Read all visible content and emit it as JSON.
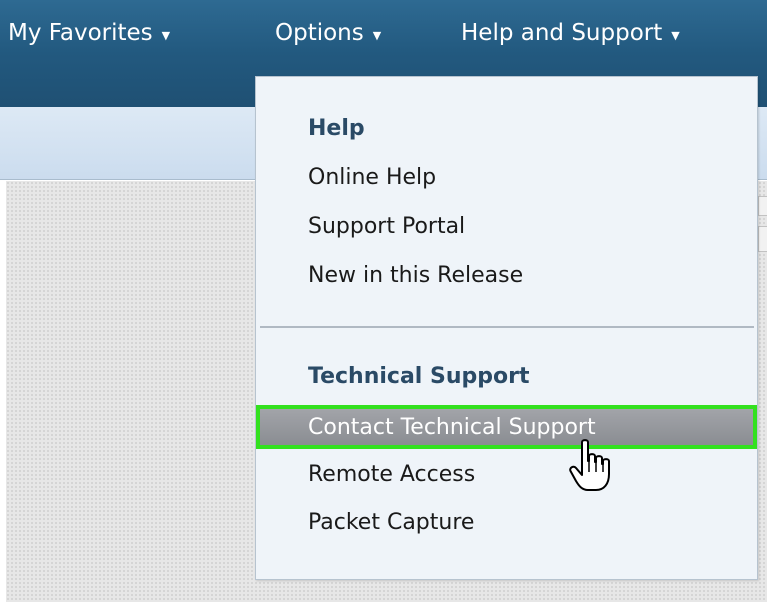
{
  "nav": {
    "favorites": "My Favorites",
    "options": "Options",
    "help_support": "Help and Support"
  },
  "dropdown": {
    "help_header": "Help",
    "online_help": "Online Help",
    "support_portal": "Support Portal",
    "new_in_release": "New in this Release",
    "tech_header": "Technical Support",
    "contact_tech": "Contact Technical Support",
    "remote_access": "Remote Access",
    "packet_capture": "Packet Capture"
  },
  "icons": {
    "caret": "chevron-down-icon",
    "cursor": "hand-pointer-icon"
  },
  "colors": {
    "topbar": "#22597f",
    "subbar": "#cbdcee",
    "dropdown_bg": "#eff4f9",
    "header_text": "#2a4a66",
    "highlight_bg": "#8a8d92",
    "highlight_border": "#33e11f"
  }
}
